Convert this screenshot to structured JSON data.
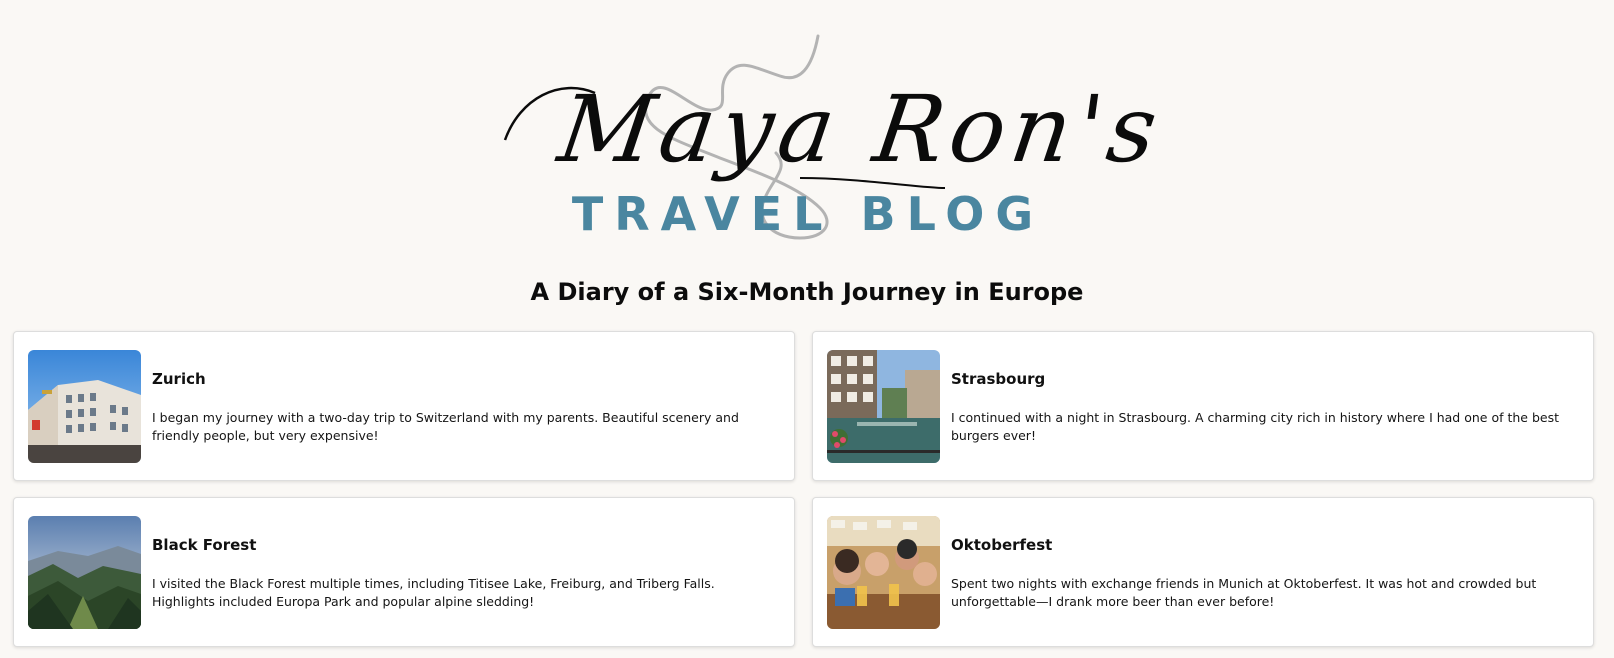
{
  "logo": {
    "script_text": "Maya Ron's",
    "sub_text": "TRAVEL BLOG",
    "accent_color": "#4a86a0"
  },
  "subtitle": "A Diary of a Six-Month Journey in Europe",
  "cards": [
    {
      "title": "Zurich",
      "text": "I began my journey with a two-day trip to Switzerland with my parents. Beautiful scenery and friendly people, but very expensive!",
      "image": "zurich-buildings-photo"
    },
    {
      "title": "Strasbourg",
      "text": "I continued with a night in Strasbourg. A charming city rich in history where I had one of the best burgers ever!",
      "image": "strasbourg-canal-photo"
    },
    {
      "title": "Black Forest",
      "text": "I visited the Black Forest multiple times, including Titisee Lake, Freiburg, and Triberg Falls. Highlights included Europa Park and popular alpine sledding!",
      "image": "black-forest-valley-photo"
    },
    {
      "title": "Oktoberfest",
      "text": "Spent two nights with exchange friends in Munich at Oktoberfest. It was hot and crowded but unforgettable—I drank more beer than ever before!",
      "image": "oktoberfest-friends-photo"
    }
  ]
}
